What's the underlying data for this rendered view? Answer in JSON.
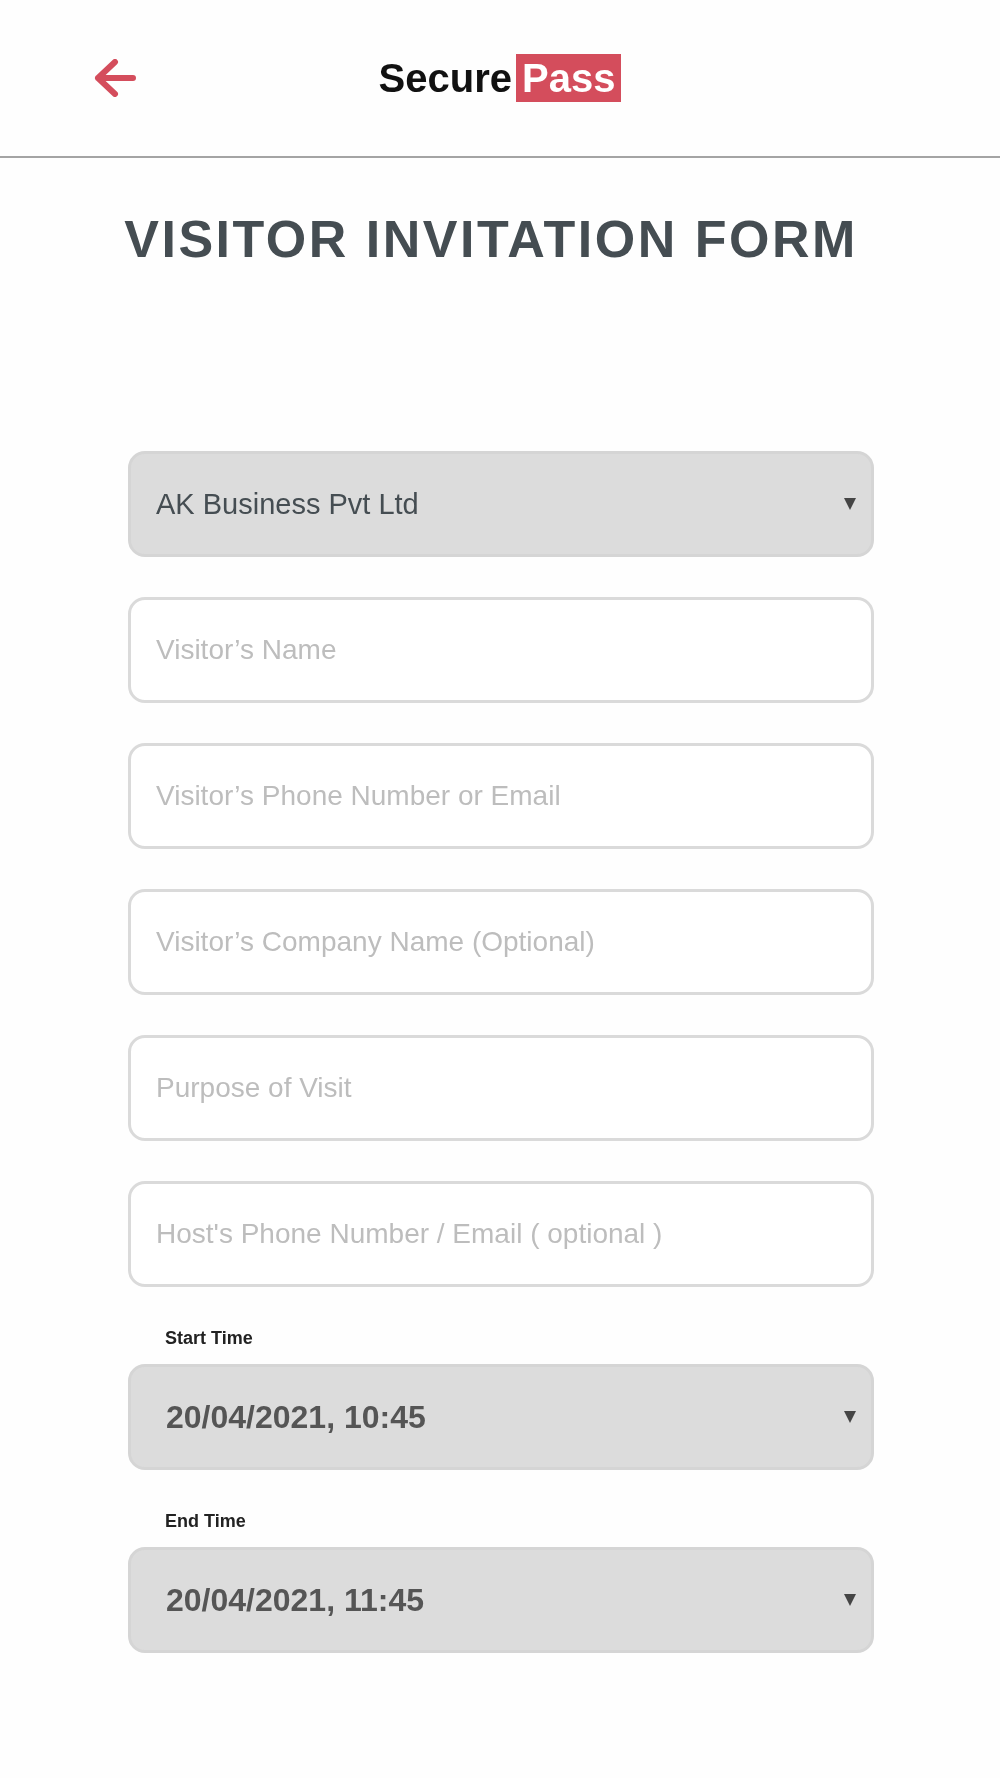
{
  "header": {
    "logo": {
      "text": "Secure",
      "badge": "Pass"
    }
  },
  "title": "VISITOR INVITATION FORM",
  "fields": [
    {
      "kind": "select",
      "value": "AK Business Pvt Ltd"
    },
    {
      "kind": "input",
      "placeholder": "Visitor’s Name"
    },
    {
      "kind": "input",
      "placeholder": "Visitor’s Phone Number or Email"
    },
    {
      "kind": "input",
      "placeholder": "Visitor’s Company Name (Optional)"
    },
    {
      "kind": "input",
      "placeholder": "Purpose of Visit"
    },
    {
      "kind": "input",
      "placeholder": "Host's Phone Number / Email ( optional )"
    },
    {
      "kind": "datetime",
      "label": "Start Time",
      "value": "20/04/2021, 10:45"
    },
    {
      "kind": "datetime",
      "label": "End Time",
      "value": "20/04/2021, 11:45"
    }
  ]
}
